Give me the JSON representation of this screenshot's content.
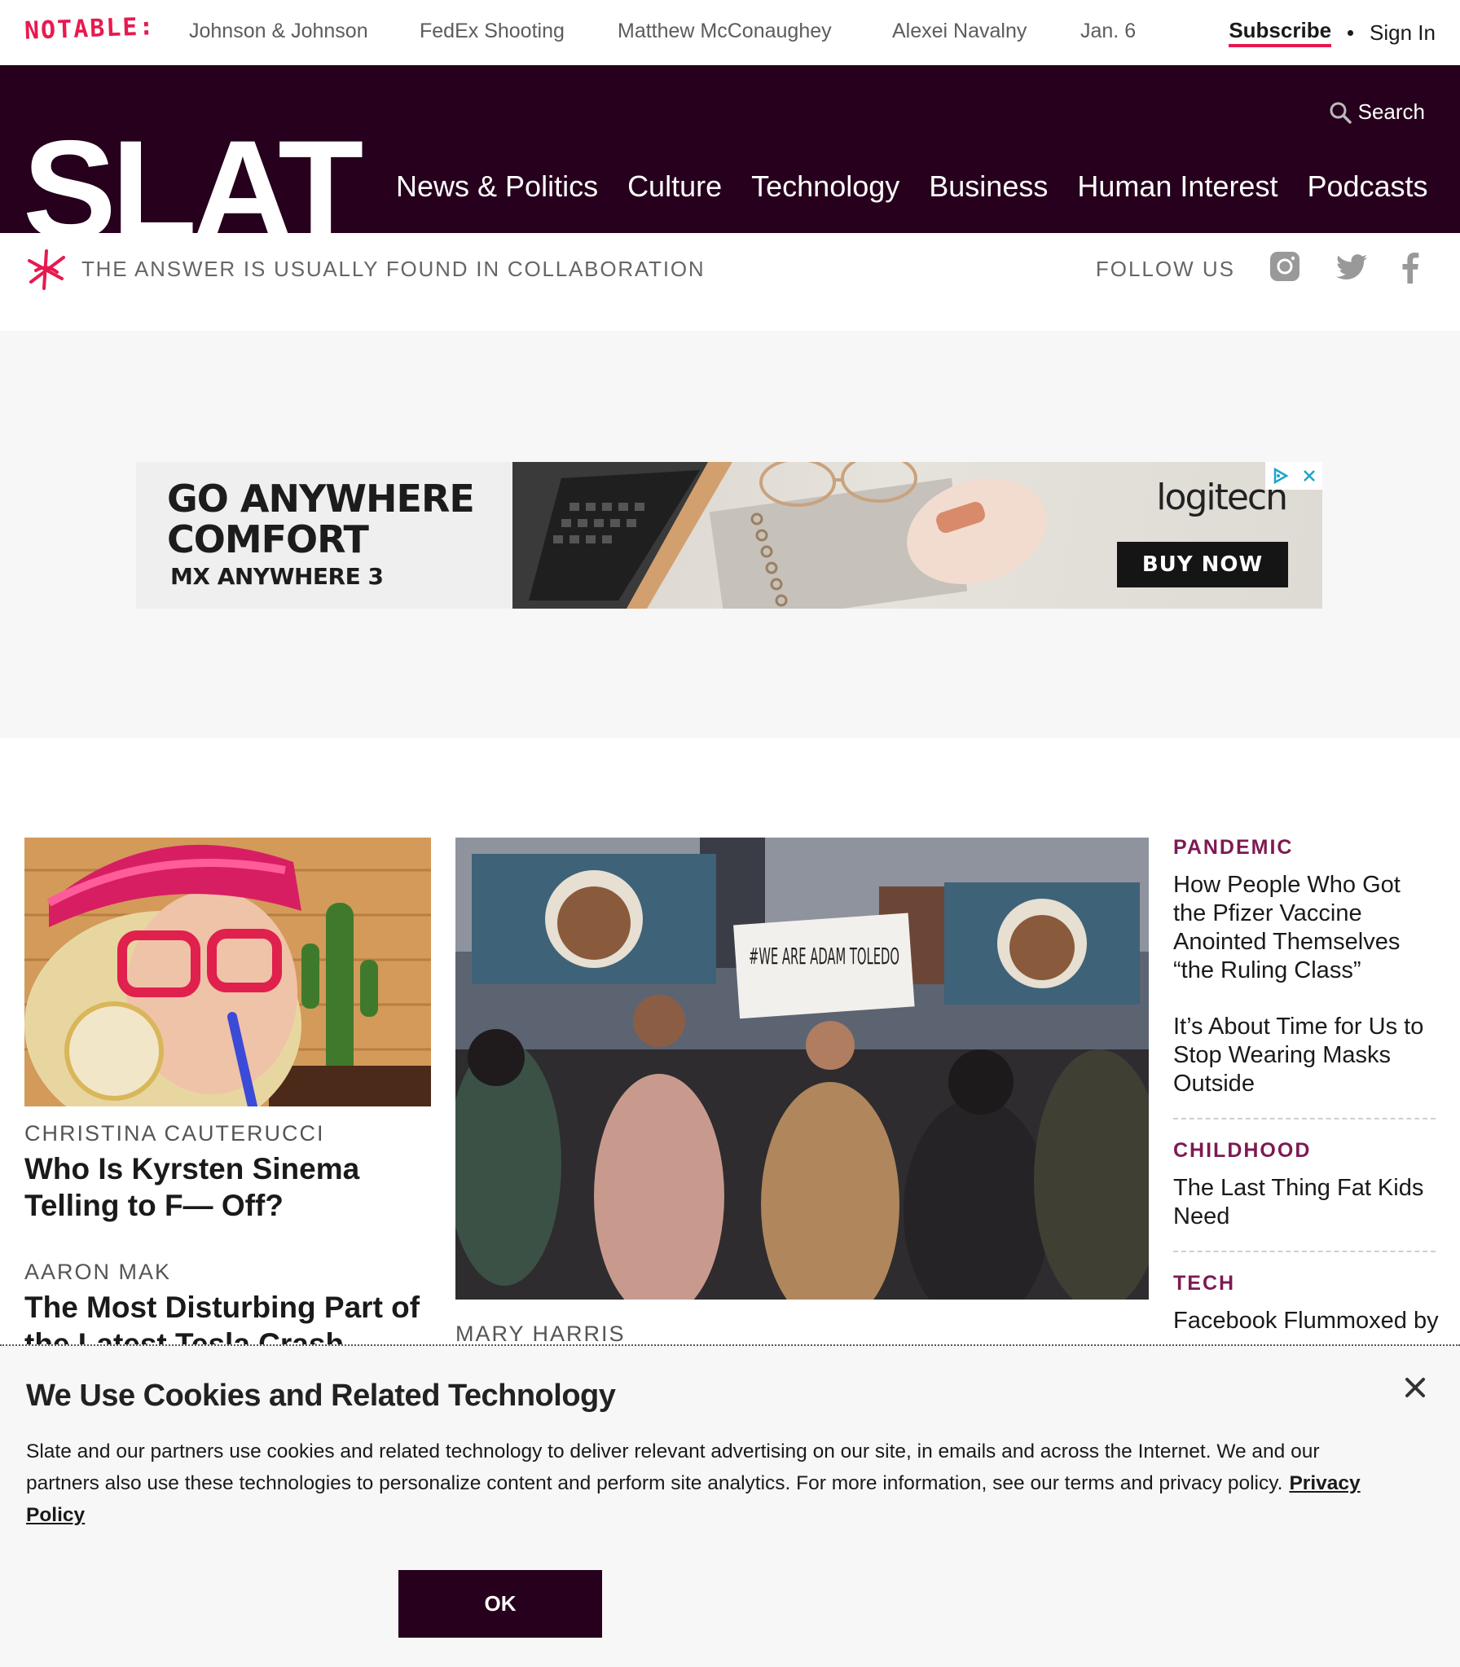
{
  "notable": {
    "label": "NOTABLE:",
    "links": [
      "Johnson & Johnson",
      "FedEx Shooting",
      "Matthew McConaughey",
      "Alexei Navalny",
      "Jan. 6"
    ]
  },
  "account": {
    "subscribe": "Subscribe",
    "signin": "Sign In"
  },
  "masthead": {
    "logo": "SLATE",
    "search_label": "Search",
    "nav": [
      "News & Politics",
      "Culture",
      "Technology",
      "Business",
      "Human Interest",
      "Podcasts"
    ]
  },
  "tagline": {
    "text": "THE ANSWER IS USUALLY FOUND IN COLLABORATION",
    "follow": "FOLLOW US"
  },
  "ad": {
    "headline_line1": "GO ANYWHERE",
    "headline_line2": "COMFORT",
    "product": "MX ANYWHERE 3",
    "brand": "logitech",
    "cta": "BUY NOW"
  },
  "lead": [
    {
      "byline": "CHRISTINA CAUTERUCCI",
      "headline": "Who Is Kyrsten Sinema Telling to F— Off?"
    },
    {
      "byline": "AARON MAK",
      "headline": "The Most Disturbing Part of the Latest Tesla Crash"
    }
  ],
  "center": {
    "sign_text": "#WE ARE ADAM TOLEDO",
    "byline": "MARY HARRIS"
  },
  "right_column": [
    {
      "kicker": "PANDEMIC",
      "headlines": [
        "How People Who Got the Pfizer Vaccine Anointed Themselves “the Ruling Class”",
        "It’s About Time for Us to Stop Wearing Masks Outside"
      ]
    },
    {
      "kicker": "CHILDHOOD",
      "headlines": [
        "The Last Thing Fat Kids Need"
      ]
    },
    {
      "kicker": "TECH",
      "headlines": [
        "Facebook Flummoxed by"
      ]
    }
  ],
  "cookie": {
    "title": "We Use Cookies and Related Technology",
    "body": "Slate and our partners use cookies and related technology to deliver relevant advertising on our site, in emails and across the Internet. We and our partners also use these technologies to personalize content and perform site analytics. For more information, see our terms and privacy policy.",
    "link": "Privacy Policy",
    "ok": "OK"
  },
  "colors": {
    "brand_plum": "#26001c",
    "notable_pink": "#e8194f",
    "kicker_plum": "#7d1a52"
  },
  "icons": [
    "search-icon",
    "slate-asterisk-icon",
    "instagram-icon",
    "twitter-icon",
    "facebook-icon",
    "adchoices-icon",
    "close-icon"
  ]
}
